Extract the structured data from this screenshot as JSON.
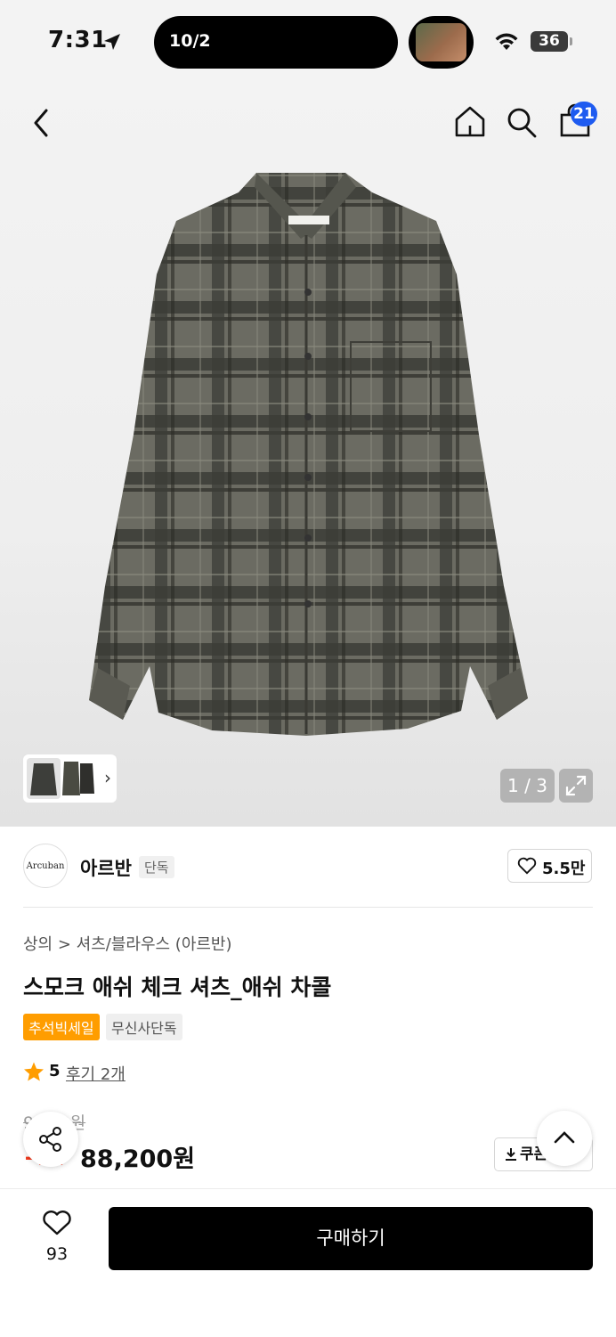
{
  "status_bar": {
    "time": "7:31",
    "island_text": "10/2",
    "battery": "36"
  },
  "header": {
    "cart_count": "21"
  },
  "gallery": {
    "counter": "1 / 3"
  },
  "brand": {
    "logo_text": "Arcuban",
    "name": "아르반",
    "tag": "단독",
    "likes": "5.5만"
  },
  "product": {
    "category": "상의 > 셔츠/블라우스 (아르반)",
    "title": "스모크 애쉬 체크 셔츠_애쉬 차콜",
    "badges": [
      "추석빅세일",
      "무신사단독"
    ],
    "rating": "5",
    "reviews": "후기 2개",
    "original_price": "9___0원",
    "discount": "1__",
    "sale_price": "88,200원",
    "coupon_label": "쿠폰"
  },
  "bottom_bar": {
    "wish_count": "93",
    "buy_label": "구매하기"
  },
  "colors": {
    "accent_blue": "#1e5bf0",
    "sale_badge": "#ff9d00",
    "discount_red": "#f23a1e",
    "buy_button": "#000000"
  },
  "icons": [
    "location-arrow-icon",
    "wifi-icon",
    "back-arrow-icon",
    "home-icon",
    "search-icon",
    "cart-icon",
    "chevron-right-icon",
    "expand-icon",
    "heart-icon",
    "star-icon",
    "download-icon",
    "share-icon",
    "chevron-up-icon"
  ]
}
